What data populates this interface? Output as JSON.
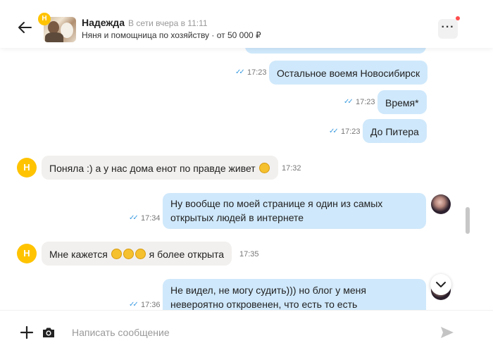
{
  "header": {
    "name": "Надежда",
    "status": "В сети вчера в 11:11",
    "subtitle": "Няня и помощница по хозяйству · от 50 000 ₽",
    "avatar_badge": "Н",
    "icons": {
      "back": "arrow-left-icon",
      "menu": "more-dots-icon"
    },
    "menu_label": "···",
    "notification_color": "#ff4d4d"
  },
  "messages": [
    {
      "dir": "out",
      "text": "Остальное воемя Новосибирск",
      "time": "17:23",
      "read": true
    },
    {
      "dir": "out",
      "text": "Время*",
      "time": "17:23",
      "read": true
    },
    {
      "dir": "out",
      "text": "До Питера",
      "time": "17:23",
      "read": true
    },
    {
      "dir": "in",
      "avatar": "Н",
      "text": "Поняла :) а у нас дома енот по правде живет",
      "emoji_after": [
        "rofl"
      ],
      "time": "17:32"
    },
    {
      "dir": "out",
      "lines": [
        "Ну вообще по моей странице я один из самых",
        "открытых людей в интернете"
      ],
      "time": "17:34",
      "read": true
    },
    {
      "dir": "in",
      "avatar": "Н",
      "text_before": "Мне кажется",
      "emojis": [
        "rofl",
        "rofl",
        "rofl"
      ],
      "text_after": "я более открыта",
      "time": "17:35"
    },
    {
      "dir": "out",
      "lines": [
        "Не видел, не могу судить))) но блог у меня",
        "невероятно откровенен, что есть то есть"
      ],
      "time": "17:36",
      "read": true
    }
  ],
  "ticks_glyph": "✓✓",
  "emoji_glyph": "😂",
  "composer": {
    "placeholder": "Написать сообщение",
    "value": "",
    "icons": {
      "attach": "plus-icon",
      "camera": "camera-icon",
      "send": "send-icon"
    }
  },
  "colors": {
    "outgoing_bubble": "#cfe8fb",
    "incoming_bubble": "#f2f0ee",
    "accent": "#ffc300",
    "read_ticks": "#3a9be0"
  }
}
